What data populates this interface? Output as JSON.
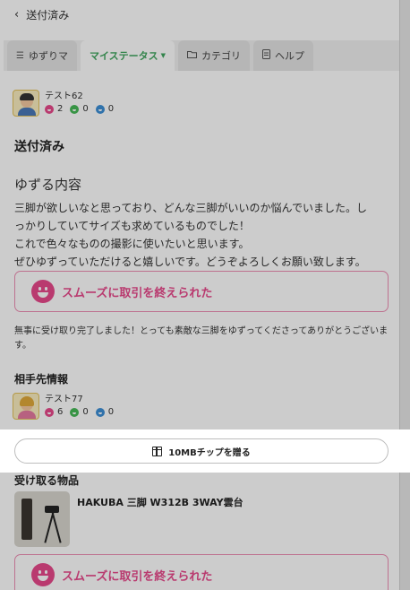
{
  "header": {
    "back_icon": "chevron-left-icon",
    "title": "送付済み"
  },
  "tabs": [
    {
      "label": "ゆずりマ",
      "icon": "list-icon"
    },
    {
      "label": "マイステータス",
      "icon": "caret-down-icon",
      "active": true
    },
    {
      "label": "カテゴリ",
      "icon": "folder-icon"
    },
    {
      "label": "ヘルプ",
      "icon": "help-doc-icon"
    }
  ],
  "owner": {
    "name": "テスト62",
    "good": "2",
    "normal": "0",
    "bad": "0"
  },
  "status_heading": "送付済み",
  "content_heading": "ゆずる内容",
  "description": [
    "三脚が欲しいなと思っており、どんな三脚がいいのか悩んでいました。し",
    "っかりしていてサイズも求めているものでした！",
    "これで色々なものの撮影に使いたいと思います。",
    "ぜひゆずっていただけると嬉しいです。どうぞよろしくお願い致します。"
  ],
  "evaluation_label": "スムーズに取引を終えられた",
  "comment": "無事に受け取り完了しました！とっても素敵な三脚をゆずってくださってありがとうございます。",
  "partner_heading": "相手先情報",
  "partner": {
    "name": "テスト77",
    "good": "6",
    "normal": "0",
    "bad": "0"
  },
  "tip_button_label": "10MBチップを贈る",
  "received_heading": "受け取る物品",
  "item_name": "HAKUBA 三脚 W312B 3WAY雲台",
  "evaluation_label_2": "スムーズに取引を終えられた",
  "colors": {
    "accent_green": "#3fa65e",
    "good_pink": "#e8498b",
    "normal_green": "#46b957",
    "bad_blue": "#3d8fd6"
  }
}
